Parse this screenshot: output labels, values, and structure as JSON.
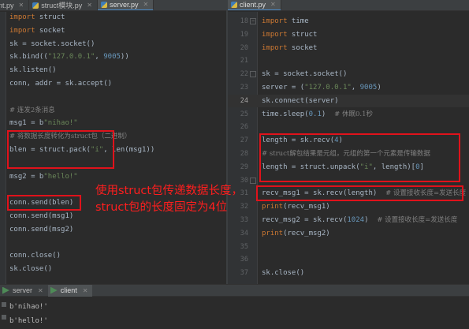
{
  "left_tabs": [
    "nt.py",
    "struct模块.py",
    "server.py"
  ],
  "right_tabs": [
    "client.py"
  ],
  "left_code": [
    {
      "tokens": [
        {
          "t": "import",
          "c": "kw"
        },
        {
          "t": " struct",
          "c": ""
        }
      ]
    },
    {
      "tokens": [
        {
          "t": "import",
          "c": "kw"
        },
        {
          "t": " socket",
          "c": ""
        }
      ]
    },
    {
      "tokens": [
        {
          "t": "sk = socket.socket()",
          "c": ""
        }
      ]
    },
    {
      "tokens": [
        {
          "t": "sk.bind((",
          "c": ""
        },
        {
          "t": "\"127.0.0.1\"",
          "c": "str"
        },
        {
          "t": ", ",
          "c": ""
        },
        {
          "t": "9005",
          "c": "num"
        },
        {
          "t": "))",
          "c": ""
        }
      ]
    },
    {
      "tokens": [
        {
          "t": "sk.listen()",
          "c": ""
        }
      ]
    },
    {
      "tokens": [
        {
          "t": "conn, addr = sk.accept()",
          "c": ""
        }
      ]
    },
    {
      "tokens": []
    },
    {
      "tokens": [
        {
          "t": "# 连发2条消息",
          "c": "cm"
        }
      ]
    },
    {
      "tokens": [
        {
          "t": "msg1 = b",
          "c": ""
        },
        {
          "t": "\"nihao!\"",
          "c": "str"
        }
      ]
    },
    {
      "tokens": [
        {
          "t": "# 将数据长度转化为struct包（二进制）",
          "c": "cm"
        }
      ]
    },
    {
      "tokens": [
        {
          "t": "blen = struct.pack(",
          "c": ""
        },
        {
          "t": "\"i\"",
          "c": "str"
        },
        {
          "t": ", len(msg1))",
          "c": ""
        }
      ]
    },
    {
      "tokens": []
    },
    {
      "tokens": [
        {
          "t": "msg2 = b",
          "c": ""
        },
        {
          "t": "\"hello!\"",
          "c": "str"
        }
      ]
    },
    {
      "tokens": []
    },
    {
      "tokens": [
        {
          "t": "conn.send(blen)",
          "c": ""
        }
      ]
    },
    {
      "tokens": [
        {
          "t": "conn.send(msg1)",
          "c": ""
        }
      ]
    },
    {
      "tokens": [
        {
          "t": "conn.send(msg2)",
          "c": ""
        }
      ]
    },
    {
      "tokens": []
    },
    {
      "tokens": [
        {
          "t": "conn.close()",
          "c": ""
        }
      ]
    },
    {
      "tokens": [
        {
          "t": "sk.close()",
          "c": ""
        }
      ]
    }
  ],
  "right_line_numbers": [
    "18",
    "19",
    "20",
    "21",
    "22",
    "23",
    "24",
    "25",
    "26",
    "27",
    "28",
    "29",
    "30",
    "31",
    "32",
    "33",
    "34",
    "35",
    "36",
    "37"
  ],
  "right_code": [
    {
      "tokens": [
        {
          "t": "import",
          "c": "kw"
        },
        {
          "t": " time",
          "c": ""
        }
      ]
    },
    {
      "tokens": [
        {
          "t": "import",
          "c": "kw"
        },
        {
          "t": " struct",
          "c": ""
        }
      ]
    },
    {
      "tokens": [
        {
          "t": "import",
          "c": "kw"
        },
        {
          "t": " socket",
          "c": ""
        }
      ]
    },
    {
      "tokens": []
    },
    {
      "tokens": [
        {
          "t": "sk = socket.socket()",
          "c": ""
        }
      ]
    },
    {
      "tokens": [
        {
          "t": "server = (",
          "c": ""
        },
        {
          "t": "\"127.0.0.1\"",
          "c": "str"
        },
        {
          "t": ", ",
          "c": ""
        },
        {
          "t": "9005",
          "c": "num"
        },
        {
          "t": ")",
          "c": ""
        }
      ]
    },
    {
      "tokens": [
        {
          "t": "sk.connect(server)",
          "c": ""
        }
      ]
    },
    {
      "tokens": [
        {
          "t": "time.sleep(",
          "c": ""
        },
        {
          "t": "0.1",
          "c": "num"
        },
        {
          "t": ")  ",
          "c": ""
        },
        {
          "t": "# 休眠0.1秒",
          "c": "cm"
        }
      ]
    },
    {
      "tokens": []
    },
    {
      "tokens": [
        {
          "t": "length = sk.recv(",
          "c": ""
        },
        {
          "t": "4",
          "c": "num"
        },
        {
          "t": ")",
          "c": ""
        }
      ]
    },
    {
      "tokens": [
        {
          "t": "# struct解包结果是元组，元组的第一个元素是传输数据",
          "c": "cm"
        }
      ]
    },
    {
      "tokens": [
        {
          "t": "length = struct.unpack(",
          "c": ""
        },
        {
          "t": "\"i\"",
          "c": "str"
        },
        {
          "t": ", length)[",
          "c": ""
        },
        {
          "t": "0",
          "c": "num"
        },
        {
          "t": "]",
          "c": ""
        }
      ]
    },
    {
      "tokens": []
    },
    {
      "tokens": [
        {
          "t": "recv_msg1 = sk.recv(length)  ",
          "c": ""
        },
        {
          "t": "# 设置接收长度=发送长度",
          "c": "cm"
        }
      ]
    },
    {
      "tokens": [
        {
          "t": "print",
          "c": "kw"
        },
        {
          "t": "(recv_msg1)",
          "c": ""
        }
      ]
    },
    {
      "tokens": [
        {
          "t": "recv_msg2 = sk.recv(",
          "c": ""
        },
        {
          "t": "1024",
          "c": "num"
        },
        {
          "t": ")  ",
          "c": ""
        },
        {
          "t": "# 设置接收长度=发送长度",
          "c": "cm"
        }
      ]
    },
    {
      "tokens": [
        {
          "t": "print",
          "c": "kw"
        },
        {
          "t": "(recv_msg2)",
          "c": ""
        }
      ]
    },
    {
      "tokens": []
    },
    {
      "tokens": []
    },
    {
      "tokens": [
        {
          "t": "sk.close()",
          "c": ""
        }
      ]
    }
  ],
  "annotation": {
    "line1": "使用struct包传递数据长度，",
    "line2": "struct包的长度固定为4位",
    "color": "#ff1e1e"
  },
  "run_tabs": [
    "server",
    "client"
  ],
  "output_lines": [
    "b'nihao!'",
    "b'hello!'"
  ],
  "colors": {
    "keyword": "#cc7832",
    "string": "#6a8759",
    "number": "#6897bb",
    "comment": "#808080",
    "box": "#e0121b",
    "tab_underline": "#4a88c7"
  }
}
